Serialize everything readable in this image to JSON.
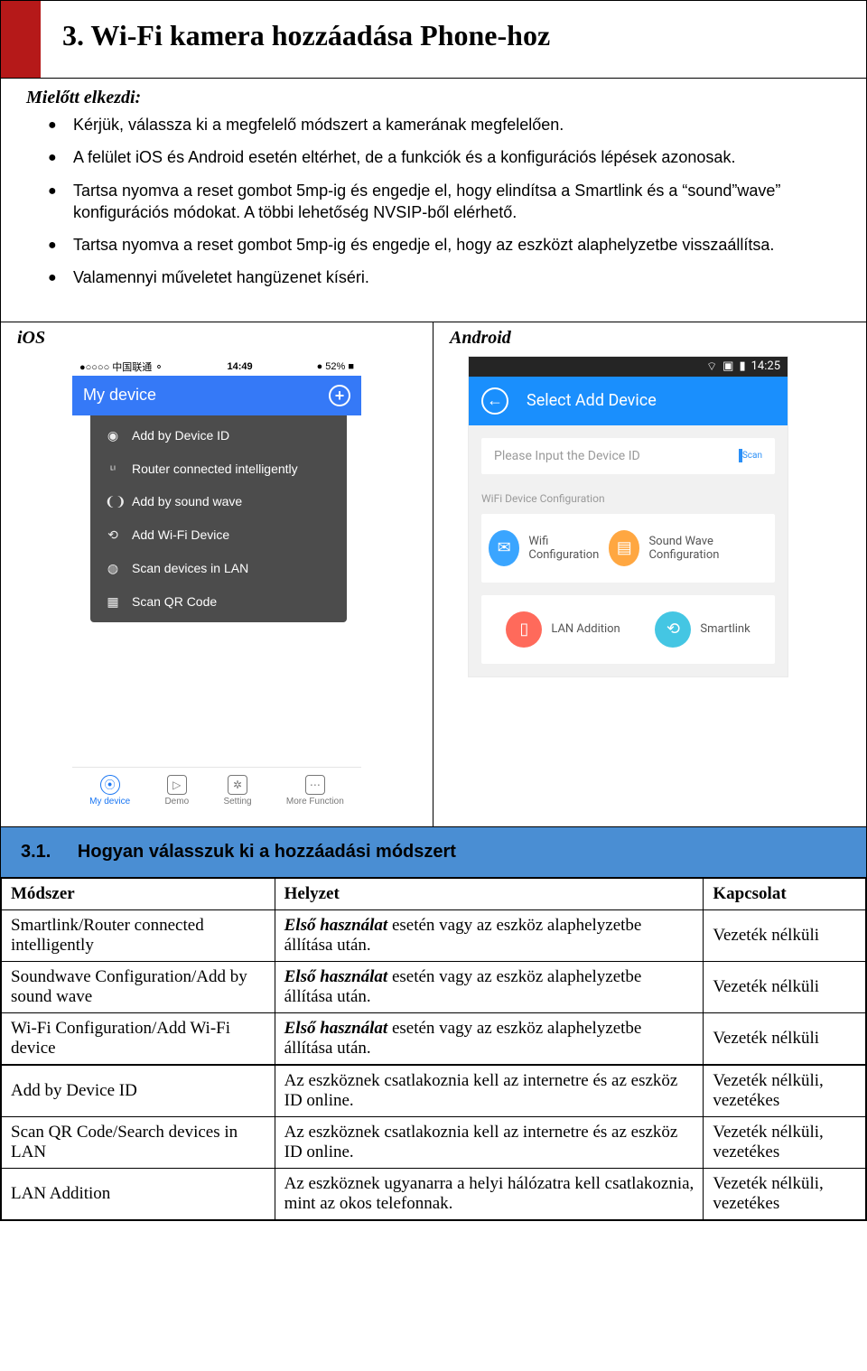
{
  "heading": "3. Wi-Fi kamera hozzáadása Phone-hoz",
  "intro": {
    "subhead": "Mielőtt elkezdi:",
    "bullets": [
      "Kérjük, válassza ki a megfelelő módszert a kamerának megfelelően.",
      "A felület iOS és Android esetén eltérhet, de a funkciók és a konfigurációs lépések azonosak.",
      "Tartsa nyomva a reset gombot 5mp-ig és engedje el, hogy elindítsa a Smartlink és a “sound”wave” konfigurációs módokat. A többi lehetőség NVSIP-ből elérhető.",
      "Tartsa nyomva a reset gombot 5mp-ig és engedje el, hogy az eszközt alaphelyzetbe visszaállítsa.",
      "Valamennyi műveletet hangüzenet kíséri."
    ]
  },
  "ios": {
    "label": "iOS",
    "status_left": "●○○○○ 中国联通 ⚬",
    "status_time": "14:49",
    "status_right": "● 52% ■",
    "nav_title": "My device",
    "menu": [
      "Add by Device ID",
      "Router connected intelligently",
      "Add by sound wave",
      "Add Wi-Fi Device",
      "Scan devices in LAN",
      "Scan QR Code"
    ],
    "tabs": [
      "My device",
      "Demo",
      "Setting",
      "More Function"
    ]
  },
  "android": {
    "label": "Android",
    "status_time": "14:25",
    "header_title": "Select Add Device",
    "input_placeholder": "Please Input the Device ID",
    "scan_label": "Scan",
    "section_label": "WiFi Device Configuration",
    "items": {
      "wifi": "Wifi Configuration",
      "soundwave": "Sound Wave Configuration",
      "lan": "LAN Addition",
      "smartlink": "Smartlink"
    }
  },
  "section31": {
    "num": "3.1.",
    "title": "Hogyan válasszuk ki a hozzáadási módszert"
  },
  "table": {
    "headers": {
      "method": "Módszer",
      "situation": "Helyzet",
      "connection": "Kapcsolat"
    },
    "rows": [
      {
        "method": "Smartlink/Router connected intelligently",
        "sit_lead": "Első használat",
        "sit_rest": " esetén vagy az eszköz alaphelyzetbe állítása után.",
        "conn": "Vezeték nélküli"
      },
      {
        "method": "Soundwave Configuration/Add by sound wave",
        "sit_lead": "Első használat",
        "sit_rest": " esetén vagy az eszköz alaphelyzetbe állítása után.",
        "conn": "Vezeték nélküli"
      },
      {
        "method": "Wi-Fi Configuration/Add Wi-Fi device",
        "sit_lead": "Első használat",
        "sit_rest": " esetén vagy az eszköz alaphelyzetbe állítása után.",
        "conn": "Vezeték nélküli"
      },
      {
        "method": "Add by Device ID",
        "sit_lead": "",
        "sit_rest": "Az eszköznek csatlakoznia kell az internetre és az eszköz ID online.",
        "conn": "Vezeték nélküli, vezetékes"
      },
      {
        "method": "Scan QR Code/Search devices in LAN",
        "sit_lead": "",
        "sit_rest": "Az eszköznek csatlakoznia kell az internetre és az eszköz ID online.",
        "conn": "Vezeték nélküli, vezetékes"
      },
      {
        "method": "LAN Addition",
        "sit_lead": "",
        "sit_rest": "Az eszköznek ugyanarra a helyi hálózatra kell csatlakoznia, mint az okos telefonnak.",
        "conn": "Vezeték nélküli, vezetékes"
      }
    ]
  }
}
